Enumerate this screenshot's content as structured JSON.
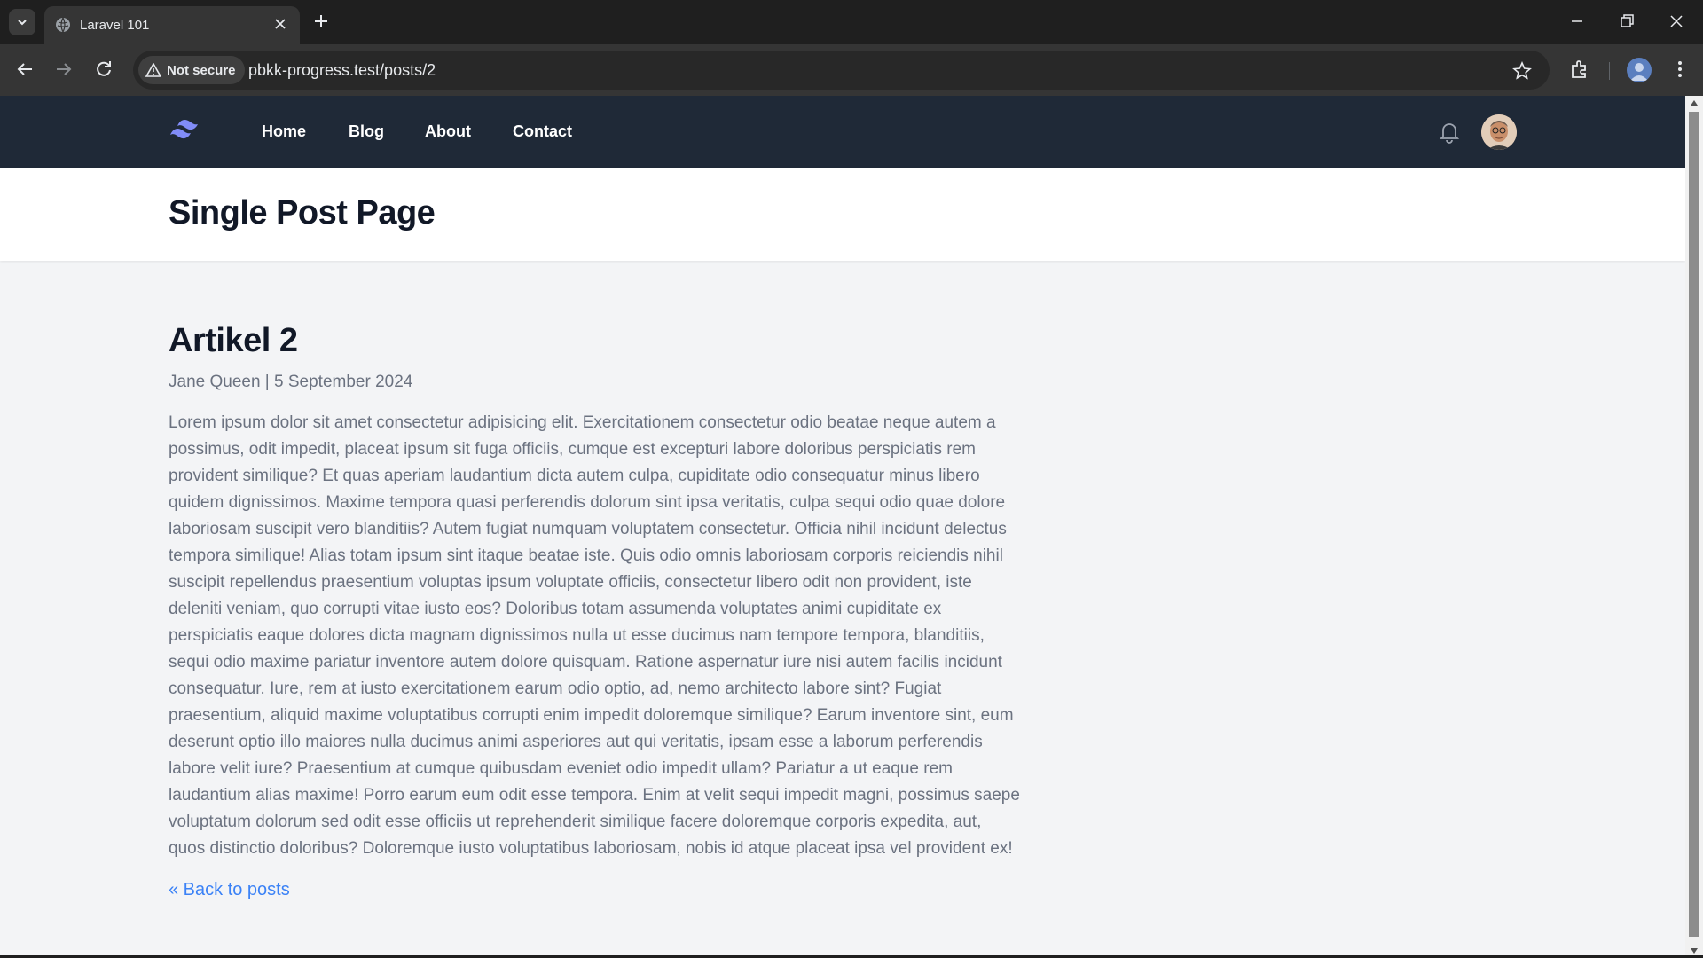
{
  "browser": {
    "tab_title": "Laravel 101",
    "security_label": "Not secure",
    "url": "pbkk-progress.test/posts/2"
  },
  "site": {
    "nav": [
      "Home",
      "Blog",
      "About",
      "Contact"
    ],
    "colors": {
      "nav_bg": "#1f2937",
      "logo": "#818cf8",
      "link": "#3b82f6"
    }
  },
  "header": {
    "title": "Single Post Page"
  },
  "post": {
    "title": "Artikel 2",
    "meta": "Jane Queen | 5 September 2024",
    "body": "Lorem ipsum dolor sit amet consectetur adipisicing elit. Exercitationem consectetur odio beatae neque autem a possimus, odit impedit, placeat ipsum sit fuga officiis, cumque est excepturi labore doloribus perspiciatis rem provident similique? Et quas aperiam laudantium dicta autem culpa, cupiditate odio consequatur minus libero quidem dignissimos. Maxime tempora quasi perferendis dolorum sint ipsa veritatis, culpa sequi odio quae dolore laboriosam suscipit vero blanditiis? Autem fugiat numquam voluptatem consectetur. Officia nihil incidunt delectus tempora similique! Alias totam ipsum sint itaque beatae iste. Quis odio omnis laboriosam corporis reiciendis nihil suscipit repellendus praesentium voluptas ipsum voluptate officiis, consectetur libero odit non provident, iste deleniti veniam, quo corrupti vitae iusto eos? Doloribus totam assumenda voluptates animi cupiditate ex perspiciatis eaque dolores dicta magnam dignissimos nulla ut esse ducimus nam tempore tempora, blanditiis, sequi odio maxime pariatur inventore autem dolore quisquam. Ratione aspernatur iure nisi autem facilis incidunt consequatur. Iure, rem at iusto exercitationem earum odio optio, ad, nemo architecto labore sint? Fugiat praesentium, aliquid maxime voluptatibus corrupti enim impedit doloremque similique? Earum inventore sint, eum deserunt optio illo maiores nulla ducimus animi asperiores aut qui veritatis, ipsam esse a laborum perferendis labore velit iure? Praesentium at cumque quibusdam eveniet odio impedit ullam? Pariatur a ut eaque rem laudantium alias maxime! Porro earum eum odit esse tempora. Enim at velit sequi impedit magni, possimus saepe voluptatum dolorum sed odit esse officiis ut reprehenderit similique facere doloremque corporis expedita, aut, quos distinctio doloribus? Doloremque iusto voluptatibus laboriosam, nobis id atque placeat ipsa vel provident ex!",
    "back_link": "« Back to posts"
  }
}
